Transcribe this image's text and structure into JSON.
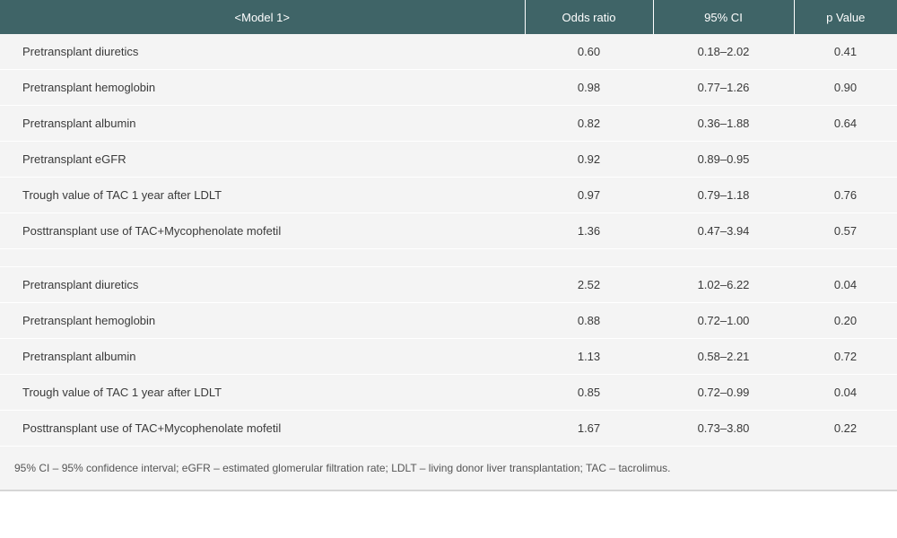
{
  "table": {
    "headers": [
      "<Model 1>",
      "Odds ratio",
      "95% CI",
      "p Value"
    ],
    "section1": [
      {
        "label": "Pretransplant diuretics",
        "or": "0.60",
        "ci": "0.18–2.02",
        "p": "0.41"
      },
      {
        "label": "Pretransplant hemoglobin",
        "or": "0.98",
        "ci": "0.77–1.26",
        "p": "0.90"
      },
      {
        "label": "Pretransplant albumin",
        "or": "0.82",
        "ci": "0.36–1.88",
        "p": "0.64"
      },
      {
        "label": "Pretransplant eGFR",
        "or": "0.92",
        "ci": "0.89–0.95",
        "p": ""
      },
      {
        "label": "Trough value of TAC 1 year after LDLT",
        "or": "0.97",
        "ci": "0.79–1.18",
        "p": "0.76"
      },
      {
        "label": "Posttransplant use of TAC+Mycophenolate mofetil",
        "or": "1.36",
        "ci": "0.47–3.94",
        "p": "0.57"
      }
    ],
    "section2": [
      {
        "label": "Pretransplant diuretics",
        "or": "2.52",
        "ci": "1.02–6.22",
        "p": "0.04"
      },
      {
        "label": "Pretransplant hemoglobin",
        "or": "0.88",
        "ci": "0.72–1.00",
        "p": "0.20"
      },
      {
        "label": "Pretransplant albumin",
        "or": "1.13",
        "ci": "0.58–2.21",
        "p": "0.72"
      },
      {
        "label": "Trough value of TAC 1 year after LDLT",
        "or": "0.85",
        "ci": "0.72–0.99",
        "p": "0.04"
      },
      {
        "label": "Posttransplant use of TAC+Mycophenolate mofetil",
        "or": "1.67",
        "ci": "0.73–3.80",
        "p": "0.22"
      }
    ]
  },
  "footnote": "95% CI – 95% confidence interval; eGFR – estimated glomerular filtration rate; LDLT – living donor liver transplantation; TAC – tacrolimus."
}
